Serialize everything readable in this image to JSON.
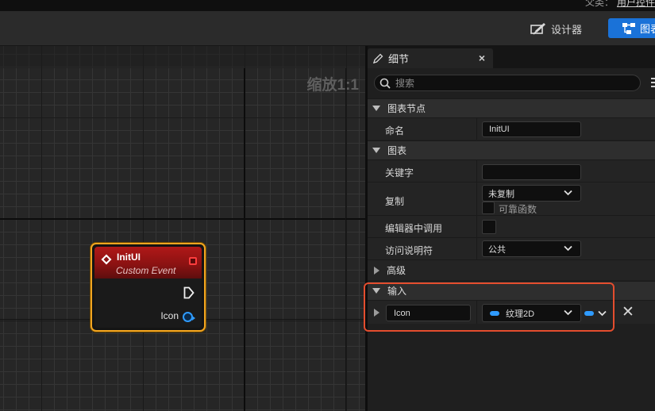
{
  "app": {
    "parent_class_label": "父类：",
    "parent_class_value": "用户控件"
  },
  "toolbar": {
    "designer_label": "设计器",
    "graph_label": "图表"
  },
  "graph": {
    "zoom_label": "缩放1:1",
    "node": {
      "title": "InitUI",
      "subtitle": "Custom Event",
      "output_pin_label": "Icon"
    }
  },
  "details": {
    "tab_label": "细节",
    "tab_close": "×",
    "search_placeholder": "搜索",
    "sections": {
      "graph_node": "图表节点",
      "graph": "图表",
      "advanced": "高级",
      "inputs": "输入"
    },
    "fields": {
      "name_label": "命名",
      "name_value": "InitUI",
      "keywords_label": "关键字",
      "keywords_value": "",
      "replicates_label": "复制",
      "replicates_value": "未复制",
      "reliable_label": "可靠函数",
      "call_in_editor_label": "编辑器中调用",
      "access_specifier_label": "访问说明符",
      "access_specifier_value": "公共"
    },
    "input_param": {
      "name": "Icon",
      "type": "纹理2D",
      "remove": "✕"
    }
  },
  "colors": {
    "accent_blue": "#1a72d8",
    "node_selected": "#f2a521",
    "node_header": "#b01818",
    "object_pin": "#2f9bff",
    "highlight_box": "#e44d2e"
  }
}
